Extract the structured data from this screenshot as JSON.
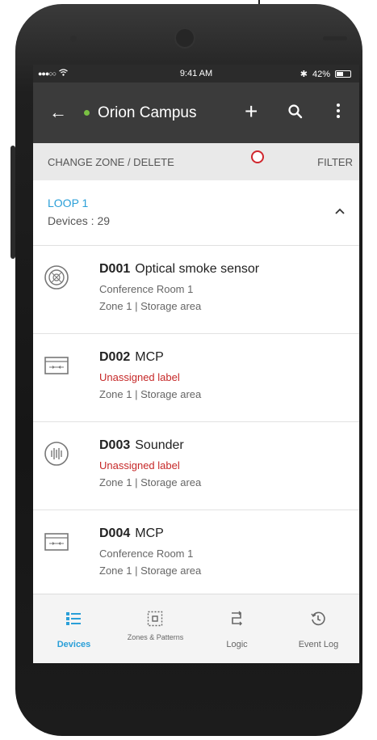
{
  "status_bar": {
    "time": "9:41 AM",
    "battery": "42%"
  },
  "app_bar": {
    "title": "Orion Campus"
  },
  "actions": {
    "left": "CHANGE ZONE / DELETE",
    "right": "FILTER"
  },
  "loop": {
    "title": "LOOP 1",
    "devices": "Devices : 29"
  },
  "devices": [
    {
      "id": "D001",
      "name": "Optical smoke sensor",
      "label": "Conference Room 1",
      "label_state": "normal",
      "zone": "Zone 1 | Storage area",
      "icon": "smoke-sensor-icon"
    },
    {
      "id": "D002",
      "name": "MCP",
      "label": "Unassigned label",
      "label_state": "warning",
      "zone": "Zone 1 | Storage area",
      "icon": "mcp-icon"
    },
    {
      "id": "D003",
      "name": "Sounder",
      "label": "Unassigned label",
      "label_state": "warning",
      "zone": "Zone 1 | Storage area",
      "icon": "sounder-icon"
    },
    {
      "id": "D004",
      "name": "MCP",
      "label": "Conference Room 1",
      "label_state": "normal",
      "zone": "Zone 1 | Storage area",
      "icon": "mcp-icon"
    }
  ],
  "bottom_nav": [
    {
      "label": "Devices",
      "active": true
    },
    {
      "label": "Zones & Patterns",
      "active": false
    },
    {
      "label": "Logic",
      "active": false
    },
    {
      "label": "Event Log",
      "active": false
    }
  ],
  "colors": {
    "accent": "#2a9fd8",
    "warning": "#c62828",
    "appbar": "#3b3b3b",
    "online": "#7ac143",
    "annotation": "#d0262d"
  }
}
